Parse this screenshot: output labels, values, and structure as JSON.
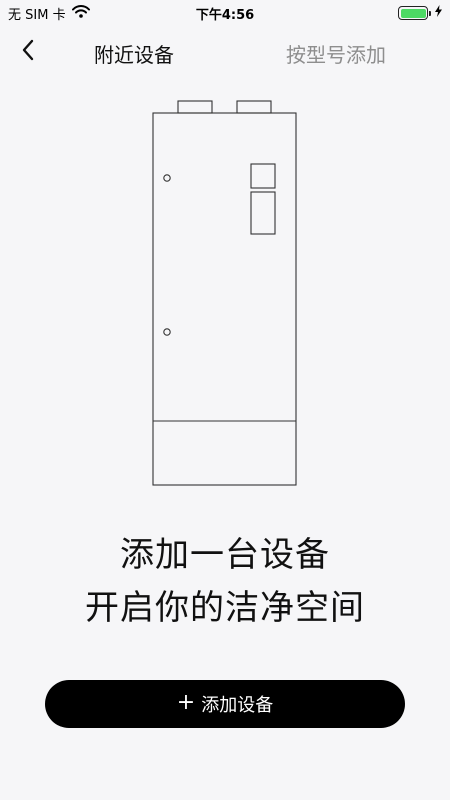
{
  "status_bar": {
    "carrier": "无 SIM 卡",
    "time": "下午4:56",
    "battery_level": 1.0,
    "charging": true,
    "icons": [
      "wifi-icon",
      "battery-icon",
      "charging-bolt-icon"
    ]
  },
  "nav": {
    "back_icon": "chevron-left-icon",
    "title": "附近设备",
    "right_action": "按型号添加"
  },
  "illustration": {
    "subject": "device-outline-illustration"
  },
  "headline": {
    "line1": "添加一台设备",
    "line2": "开启你的洁净空间"
  },
  "add_button": {
    "icon": "plus-icon",
    "icon_glyph": "+",
    "label": "添加设备"
  },
  "colors": {
    "background": "#f6f6f8",
    "button": "#000000",
    "button_text": "#ffffff",
    "secondary_text": "#8e8e8e",
    "battery": "#4cd964"
  }
}
